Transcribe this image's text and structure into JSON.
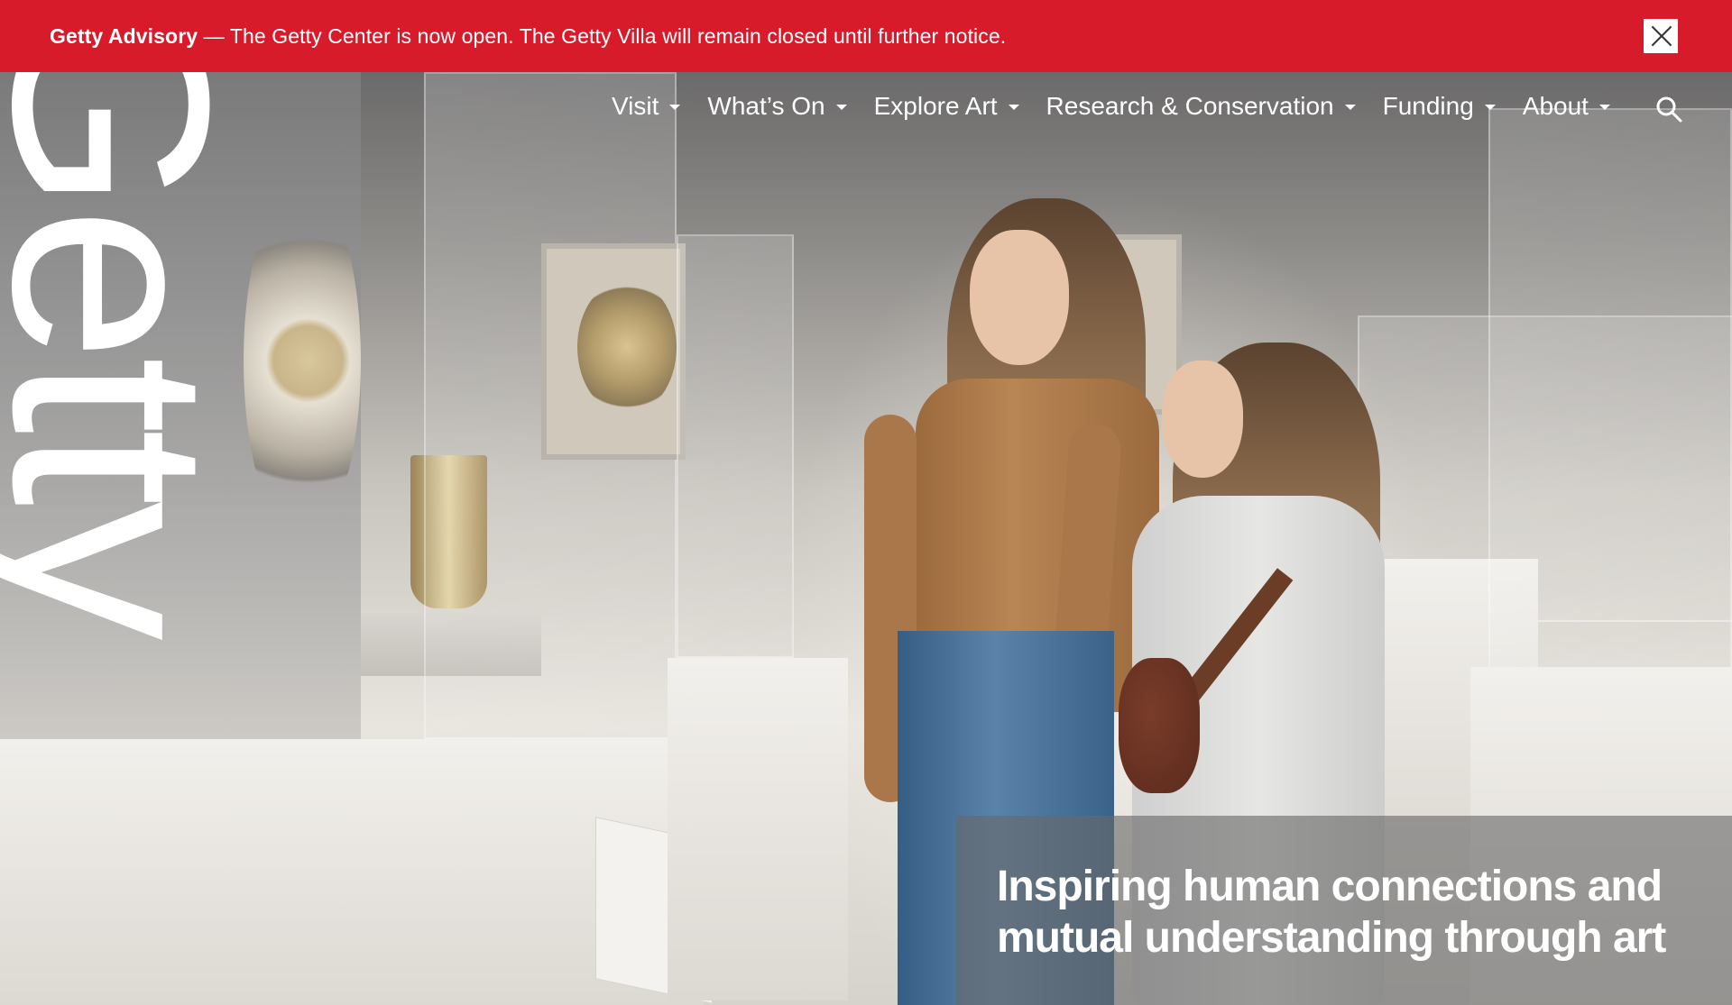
{
  "advisory": {
    "title": "Getty Advisory",
    "message": " — The Getty Center is now open. The Getty Villa will remain closed until further notice.",
    "close_icon": "close-icon",
    "background_color": "#d81b2b"
  },
  "brand": {
    "wordmark": "Getty"
  },
  "nav": {
    "items": [
      {
        "label": "Visit"
      },
      {
        "label": "What’s On"
      },
      {
        "label": "Explore Art"
      },
      {
        "label": "Research & Conservation"
      },
      {
        "label": "Funding"
      },
      {
        "label": "About"
      }
    ],
    "search_icon": "search-icon",
    "dropdown_icon": "chevron-down-icon"
  },
  "hero": {
    "tagline": "Inspiring human connections and mutual understanding through art"
  }
}
